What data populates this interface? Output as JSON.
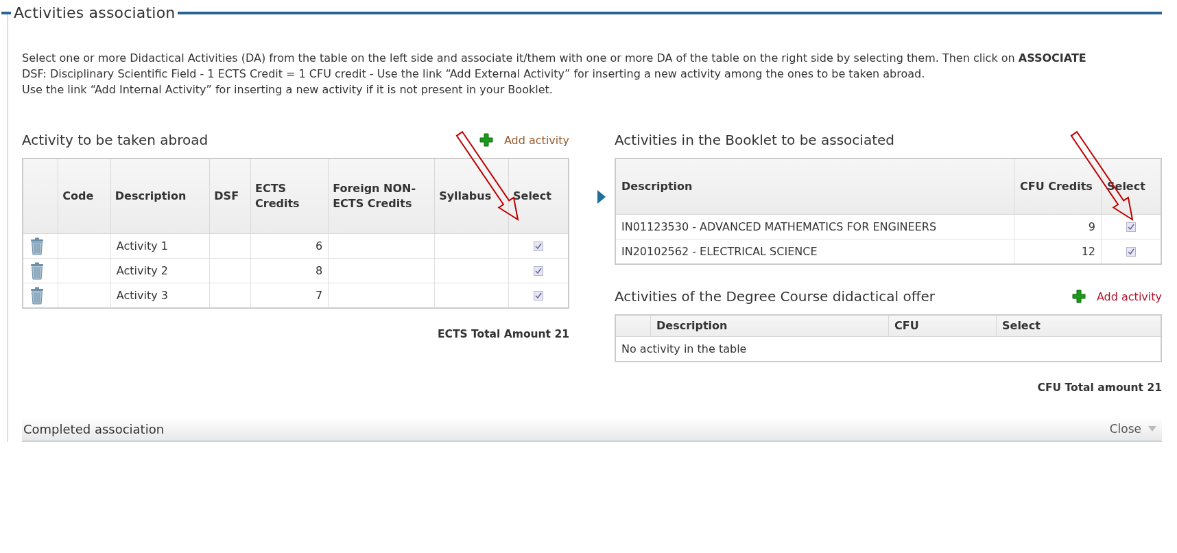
{
  "section": {
    "title": "Activities association"
  },
  "instructions": [
    "Select one or more Didactical Activities (DA) from the table on the left side and associate it/them with one or more DA of the table on the right side by selecting them. Then click on **ASSOCIATE**",
    "DSF: Disciplinary Scientific Field - 1 ECTS Credit = 1 CFU credit - Use the link “Add External Activity” for inserting a new activity among the ones to be taken abroad.",
    "Use the link “Add Internal Activity” for inserting a new activity if it is not present in your Booklet."
  ],
  "abroad": {
    "title": "Activity to be taken abroad",
    "add_link": "Add activity",
    "columns": [
      "Code",
      "Description",
      "DSF",
      "ECTS Credits",
      "Foreign NON-ECTS Credits",
      "Syllabus",
      "Select"
    ],
    "rows": [
      {
        "description": "Activity 1",
        "ects": "6",
        "selected": true
      },
      {
        "description": "Activity 2",
        "ects": "8",
        "selected": true
      },
      {
        "description": "Activity 3",
        "ects": "7",
        "selected": true
      }
    ],
    "total": "ECTS Total Amount 21"
  },
  "booklet": {
    "title": "Activities in the Booklet to be associated",
    "columns": [
      "Description",
      "CFU Credits",
      "Select"
    ],
    "rows": [
      {
        "description": "IN01123530 - ADVANCED MATHEMATICS FOR ENGINEERS",
        "cfu": "9",
        "selected": true
      },
      {
        "description": "IN20102562 - ELECTRICAL SCIENCE",
        "cfu": "12",
        "selected": true
      }
    ]
  },
  "offer": {
    "title": "Activities of the Degree Course didactical offer",
    "add_link": "Add activity",
    "columns": [
      "Description",
      "CFU",
      "Select"
    ],
    "empty_message": "No activity in the table",
    "total": "CFU Total amount 21"
  },
  "completed": {
    "title": "Completed association",
    "close": "Close"
  }
}
